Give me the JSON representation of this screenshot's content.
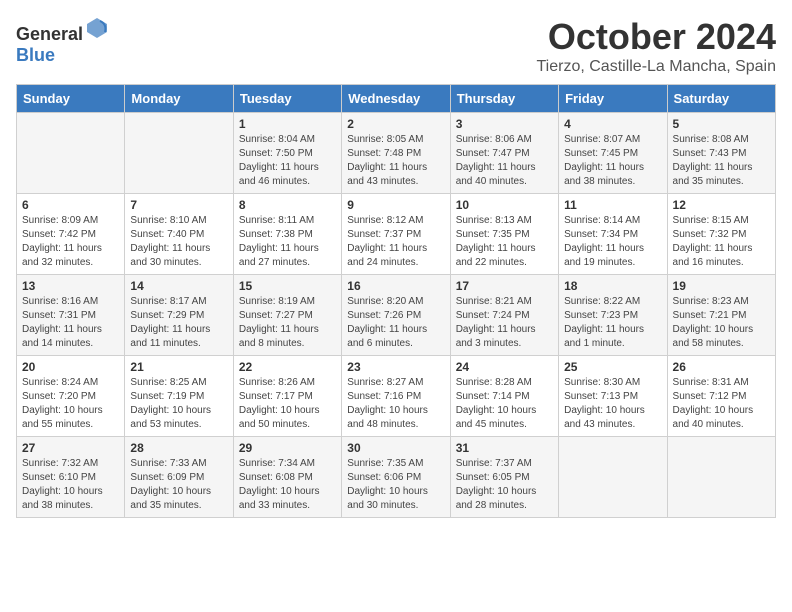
{
  "header": {
    "logo_general": "General",
    "logo_blue": "Blue",
    "month": "October 2024",
    "location": "Tierzo, Castille-La Mancha, Spain"
  },
  "days_of_week": [
    "Sunday",
    "Monday",
    "Tuesday",
    "Wednesday",
    "Thursday",
    "Friday",
    "Saturday"
  ],
  "weeks": [
    [
      {
        "day": "",
        "content": ""
      },
      {
        "day": "",
        "content": ""
      },
      {
        "day": "1",
        "content": "Sunrise: 8:04 AM\nSunset: 7:50 PM\nDaylight: 11 hours and 46 minutes."
      },
      {
        "day": "2",
        "content": "Sunrise: 8:05 AM\nSunset: 7:48 PM\nDaylight: 11 hours and 43 minutes."
      },
      {
        "day": "3",
        "content": "Sunrise: 8:06 AM\nSunset: 7:47 PM\nDaylight: 11 hours and 40 minutes."
      },
      {
        "day": "4",
        "content": "Sunrise: 8:07 AM\nSunset: 7:45 PM\nDaylight: 11 hours and 38 minutes."
      },
      {
        "day": "5",
        "content": "Sunrise: 8:08 AM\nSunset: 7:43 PM\nDaylight: 11 hours and 35 minutes."
      }
    ],
    [
      {
        "day": "6",
        "content": "Sunrise: 8:09 AM\nSunset: 7:42 PM\nDaylight: 11 hours and 32 minutes."
      },
      {
        "day": "7",
        "content": "Sunrise: 8:10 AM\nSunset: 7:40 PM\nDaylight: 11 hours and 30 minutes."
      },
      {
        "day": "8",
        "content": "Sunrise: 8:11 AM\nSunset: 7:38 PM\nDaylight: 11 hours and 27 minutes."
      },
      {
        "day": "9",
        "content": "Sunrise: 8:12 AM\nSunset: 7:37 PM\nDaylight: 11 hours and 24 minutes."
      },
      {
        "day": "10",
        "content": "Sunrise: 8:13 AM\nSunset: 7:35 PM\nDaylight: 11 hours and 22 minutes."
      },
      {
        "day": "11",
        "content": "Sunrise: 8:14 AM\nSunset: 7:34 PM\nDaylight: 11 hours and 19 minutes."
      },
      {
        "day": "12",
        "content": "Sunrise: 8:15 AM\nSunset: 7:32 PM\nDaylight: 11 hours and 16 minutes."
      }
    ],
    [
      {
        "day": "13",
        "content": "Sunrise: 8:16 AM\nSunset: 7:31 PM\nDaylight: 11 hours and 14 minutes."
      },
      {
        "day": "14",
        "content": "Sunrise: 8:17 AM\nSunset: 7:29 PM\nDaylight: 11 hours and 11 minutes."
      },
      {
        "day": "15",
        "content": "Sunrise: 8:19 AM\nSunset: 7:27 PM\nDaylight: 11 hours and 8 minutes."
      },
      {
        "day": "16",
        "content": "Sunrise: 8:20 AM\nSunset: 7:26 PM\nDaylight: 11 hours and 6 minutes."
      },
      {
        "day": "17",
        "content": "Sunrise: 8:21 AM\nSunset: 7:24 PM\nDaylight: 11 hours and 3 minutes."
      },
      {
        "day": "18",
        "content": "Sunrise: 8:22 AM\nSunset: 7:23 PM\nDaylight: 11 hours and 1 minute."
      },
      {
        "day": "19",
        "content": "Sunrise: 8:23 AM\nSunset: 7:21 PM\nDaylight: 10 hours and 58 minutes."
      }
    ],
    [
      {
        "day": "20",
        "content": "Sunrise: 8:24 AM\nSunset: 7:20 PM\nDaylight: 10 hours and 55 minutes."
      },
      {
        "day": "21",
        "content": "Sunrise: 8:25 AM\nSunset: 7:19 PM\nDaylight: 10 hours and 53 minutes."
      },
      {
        "day": "22",
        "content": "Sunrise: 8:26 AM\nSunset: 7:17 PM\nDaylight: 10 hours and 50 minutes."
      },
      {
        "day": "23",
        "content": "Sunrise: 8:27 AM\nSunset: 7:16 PM\nDaylight: 10 hours and 48 minutes."
      },
      {
        "day": "24",
        "content": "Sunrise: 8:28 AM\nSunset: 7:14 PM\nDaylight: 10 hours and 45 minutes."
      },
      {
        "day": "25",
        "content": "Sunrise: 8:30 AM\nSunset: 7:13 PM\nDaylight: 10 hours and 43 minutes."
      },
      {
        "day": "26",
        "content": "Sunrise: 8:31 AM\nSunset: 7:12 PM\nDaylight: 10 hours and 40 minutes."
      }
    ],
    [
      {
        "day": "27",
        "content": "Sunrise: 7:32 AM\nSunset: 6:10 PM\nDaylight: 10 hours and 38 minutes."
      },
      {
        "day": "28",
        "content": "Sunrise: 7:33 AM\nSunset: 6:09 PM\nDaylight: 10 hours and 35 minutes."
      },
      {
        "day": "29",
        "content": "Sunrise: 7:34 AM\nSunset: 6:08 PM\nDaylight: 10 hours and 33 minutes."
      },
      {
        "day": "30",
        "content": "Sunrise: 7:35 AM\nSunset: 6:06 PM\nDaylight: 10 hours and 30 minutes."
      },
      {
        "day": "31",
        "content": "Sunrise: 7:37 AM\nSunset: 6:05 PM\nDaylight: 10 hours and 28 minutes."
      },
      {
        "day": "",
        "content": ""
      },
      {
        "day": "",
        "content": ""
      }
    ]
  ]
}
